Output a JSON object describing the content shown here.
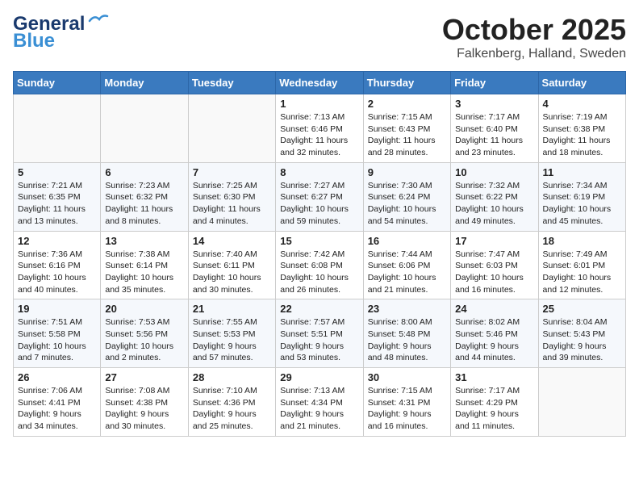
{
  "header": {
    "logo_general": "General",
    "logo_blue": "Blue",
    "month": "October 2025",
    "location": "Falkenberg, Halland, Sweden"
  },
  "weekdays": [
    "Sunday",
    "Monday",
    "Tuesday",
    "Wednesday",
    "Thursday",
    "Friday",
    "Saturday"
  ],
  "weeks": [
    [
      {
        "day": "",
        "info": ""
      },
      {
        "day": "",
        "info": ""
      },
      {
        "day": "",
        "info": ""
      },
      {
        "day": "1",
        "info": "Sunrise: 7:13 AM\nSunset: 6:46 PM\nDaylight: 11 hours\nand 32 minutes."
      },
      {
        "day": "2",
        "info": "Sunrise: 7:15 AM\nSunset: 6:43 PM\nDaylight: 11 hours\nand 28 minutes."
      },
      {
        "day": "3",
        "info": "Sunrise: 7:17 AM\nSunset: 6:40 PM\nDaylight: 11 hours\nand 23 minutes."
      },
      {
        "day": "4",
        "info": "Sunrise: 7:19 AM\nSunset: 6:38 PM\nDaylight: 11 hours\nand 18 minutes."
      }
    ],
    [
      {
        "day": "5",
        "info": "Sunrise: 7:21 AM\nSunset: 6:35 PM\nDaylight: 11 hours\nand 13 minutes."
      },
      {
        "day": "6",
        "info": "Sunrise: 7:23 AM\nSunset: 6:32 PM\nDaylight: 11 hours\nand 8 minutes."
      },
      {
        "day": "7",
        "info": "Sunrise: 7:25 AM\nSunset: 6:30 PM\nDaylight: 11 hours\nand 4 minutes."
      },
      {
        "day": "8",
        "info": "Sunrise: 7:27 AM\nSunset: 6:27 PM\nDaylight: 10 hours\nand 59 minutes."
      },
      {
        "day": "9",
        "info": "Sunrise: 7:30 AM\nSunset: 6:24 PM\nDaylight: 10 hours\nand 54 minutes."
      },
      {
        "day": "10",
        "info": "Sunrise: 7:32 AM\nSunset: 6:22 PM\nDaylight: 10 hours\nand 49 minutes."
      },
      {
        "day": "11",
        "info": "Sunrise: 7:34 AM\nSunset: 6:19 PM\nDaylight: 10 hours\nand 45 minutes."
      }
    ],
    [
      {
        "day": "12",
        "info": "Sunrise: 7:36 AM\nSunset: 6:16 PM\nDaylight: 10 hours\nand 40 minutes."
      },
      {
        "day": "13",
        "info": "Sunrise: 7:38 AM\nSunset: 6:14 PM\nDaylight: 10 hours\nand 35 minutes."
      },
      {
        "day": "14",
        "info": "Sunrise: 7:40 AM\nSunset: 6:11 PM\nDaylight: 10 hours\nand 30 minutes."
      },
      {
        "day": "15",
        "info": "Sunrise: 7:42 AM\nSunset: 6:08 PM\nDaylight: 10 hours\nand 26 minutes."
      },
      {
        "day": "16",
        "info": "Sunrise: 7:44 AM\nSunset: 6:06 PM\nDaylight: 10 hours\nand 21 minutes."
      },
      {
        "day": "17",
        "info": "Sunrise: 7:47 AM\nSunset: 6:03 PM\nDaylight: 10 hours\nand 16 minutes."
      },
      {
        "day": "18",
        "info": "Sunrise: 7:49 AM\nSunset: 6:01 PM\nDaylight: 10 hours\nand 12 minutes."
      }
    ],
    [
      {
        "day": "19",
        "info": "Sunrise: 7:51 AM\nSunset: 5:58 PM\nDaylight: 10 hours\nand 7 minutes."
      },
      {
        "day": "20",
        "info": "Sunrise: 7:53 AM\nSunset: 5:56 PM\nDaylight: 10 hours\nand 2 minutes."
      },
      {
        "day": "21",
        "info": "Sunrise: 7:55 AM\nSunset: 5:53 PM\nDaylight: 9 hours\nand 57 minutes."
      },
      {
        "day": "22",
        "info": "Sunrise: 7:57 AM\nSunset: 5:51 PM\nDaylight: 9 hours\nand 53 minutes."
      },
      {
        "day": "23",
        "info": "Sunrise: 8:00 AM\nSunset: 5:48 PM\nDaylight: 9 hours\nand 48 minutes."
      },
      {
        "day": "24",
        "info": "Sunrise: 8:02 AM\nSunset: 5:46 PM\nDaylight: 9 hours\nand 44 minutes."
      },
      {
        "day": "25",
        "info": "Sunrise: 8:04 AM\nSunset: 5:43 PM\nDaylight: 9 hours\nand 39 minutes."
      }
    ],
    [
      {
        "day": "26",
        "info": "Sunrise: 7:06 AM\nSunset: 4:41 PM\nDaylight: 9 hours\nand 34 minutes."
      },
      {
        "day": "27",
        "info": "Sunrise: 7:08 AM\nSunset: 4:38 PM\nDaylight: 9 hours\nand 30 minutes."
      },
      {
        "day": "28",
        "info": "Sunrise: 7:10 AM\nSunset: 4:36 PM\nDaylight: 9 hours\nand 25 minutes."
      },
      {
        "day": "29",
        "info": "Sunrise: 7:13 AM\nSunset: 4:34 PM\nDaylight: 9 hours\nand 21 minutes."
      },
      {
        "day": "30",
        "info": "Sunrise: 7:15 AM\nSunset: 4:31 PM\nDaylight: 9 hours\nand 16 minutes."
      },
      {
        "day": "31",
        "info": "Sunrise: 7:17 AM\nSunset: 4:29 PM\nDaylight: 9 hours\nand 11 minutes."
      },
      {
        "day": "",
        "info": ""
      }
    ]
  ]
}
